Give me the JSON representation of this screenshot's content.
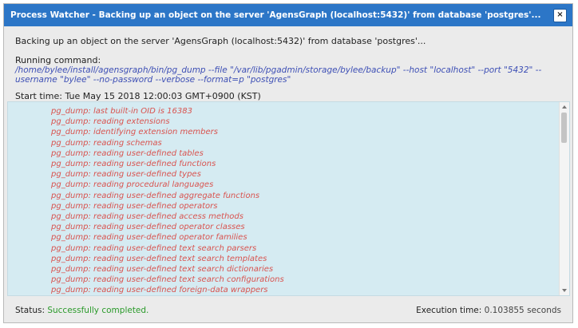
{
  "dialog": {
    "title": "Process Watcher - Backing up an object on the server 'AgensGraph (localhost:5432)' from database 'postgres'...",
    "close_label": "×",
    "description": "Backing up an object on the server 'AgensGraph (localhost:5432)' from database 'postgres'...",
    "running_label": "Running command:",
    "command": "/home/bylee/install/agensgraph/bin/pg_dump --file \"/var/lib/pgadmin/storage/bylee/backup\" --host \"localhost\" --port \"5432\" --username \"bylee\" --no-password --verbose --format=p \"postgres\"",
    "start_label": "Start time:",
    "start_value": "Tue May 15 2018 12:00:03 GMT+0900 (KST)",
    "log_lines": [
      "pg_dump: last built-in OID is 16383",
      "pg_dump: reading extensions",
      "pg_dump: identifying extension members",
      "pg_dump: reading schemas",
      "pg_dump: reading user-defined tables",
      "pg_dump: reading user-defined functions",
      "pg_dump: reading user-defined types",
      "pg_dump: reading procedural languages",
      "pg_dump: reading user-defined aggregate functions",
      "pg_dump: reading user-defined operators",
      "pg_dump: reading user-defined access methods",
      "pg_dump: reading user-defined operator classes",
      "pg_dump: reading user-defined operator families",
      "pg_dump: reading user-defined text search parsers",
      "pg_dump: reading user-defined text search templates",
      "pg_dump: reading user-defined text search dictionaries",
      "pg_dump: reading user-defined text search configurations",
      "pg_dump: reading user-defined foreign-data wrappers"
    ],
    "status_label": "Status:",
    "status_value": "Successfully completed.",
    "exec_label": "Execution time:",
    "exec_value": "0.103855 seconds"
  },
  "colors": {
    "titlebar": "#2c76c7",
    "log_background": "#d5ebf2",
    "log_text": "#d9534f",
    "command_text": "#3d4fb5",
    "status_success": "#2a9a2a"
  },
  "icons": {
    "close": "close-icon",
    "scroll_up": "chevron-up-icon",
    "scroll_down": "chevron-down-icon"
  }
}
